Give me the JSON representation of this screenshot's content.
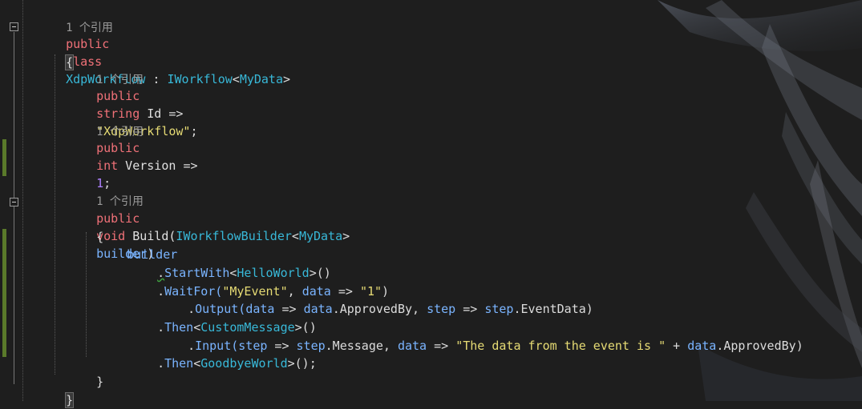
{
  "code_lens": {
    "class_refs": "1 个引用",
    "id_refs": "1 个引用",
    "version_refs": "1 个引用",
    "build_refs": "1 个引用"
  },
  "class_decl": {
    "kw_public": "public",
    "kw_class": "class",
    "name": "XdpWorkflow",
    "colon": " : ",
    "base": "IWorkflow",
    "lt": "<",
    "type_arg": "MyData",
    "gt": ">"
  },
  "open_brace": "{",
  "id_prop": {
    "kw_public": "public",
    "kw_type": "string",
    "name": " Id ",
    "arrow": "=>",
    "value": "\"XdpWorkflow\"",
    "end": ";"
  },
  "version_prop": {
    "kw_public": "public",
    "kw_type": "int",
    "name": " Version ",
    "arrow": "=>",
    "value": "1",
    "end": ";"
  },
  "build_decl": {
    "kw_public": "public",
    "kw_void": "void",
    "name": " Build(",
    "param_type": "IWorkflowBuilder",
    "lt": "<",
    "type_arg": "MyData",
    "gt": ">",
    "param": "builder",
    "close": ")"
  },
  "method_open": "{",
  "builder_var": "builder",
  "start_with": {
    "dot": ".",
    "method": "StartWith",
    "lt": "<",
    "type": "HelloWorld",
    "gt": ">()"
  },
  "wait_for": {
    "dot": ".",
    "method": "WaitFor(",
    "event": "\"MyEvent\"",
    "comma": ", ",
    "param": "data",
    "arrow": " => ",
    "key": "\"1\"",
    "close": ")"
  },
  "output": {
    "dot": ".",
    "method": "Output(",
    "p1": "data",
    "arrow1": " => ",
    "v1": "data",
    "m1": ".ApprovedBy",
    "comma": ", ",
    "p2": "step",
    "arrow2": " => ",
    "v2": "step",
    "m2": ".EventData",
    "close": ")"
  },
  "then1": {
    "dot": ".",
    "method": "Then",
    "lt": "<",
    "type": "CustomMessage",
    "gt": ">()"
  },
  "input": {
    "dot": ".",
    "method": "Input(",
    "p1": "step",
    "arrow1": " => ",
    "v1": "step",
    "m1": ".Message",
    "comma": ", ",
    "p2": "data",
    "arrow2": " => ",
    "str": "\"The data from the event is \"",
    "plus": " + ",
    "v2": "data",
    "m2": ".ApprovedBy",
    "close": ")"
  },
  "then2": {
    "dot": ".",
    "method": "Then",
    "lt": "<",
    "type": "GoodbyeWorld",
    "gt": ">();"
  },
  "method_close": "}",
  "close_brace": "}"
}
